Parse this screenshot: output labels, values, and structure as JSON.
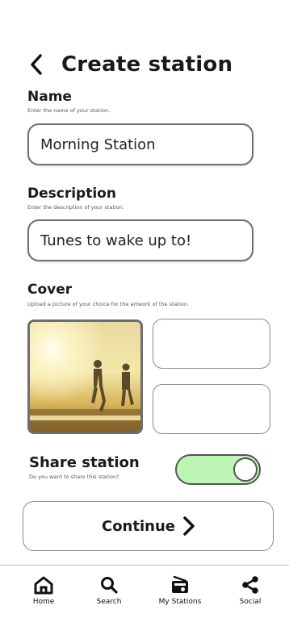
{
  "header": {
    "title": "Create station"
  },
  "name": {
    "label": "Name",
    "hint": "Enter the name of your station.",
    "value": "Morning Station"
  },
  "description": {
    "label": "Description",
    "hint": "Enter the description of your station.",
    "value": "Tunes to wake up to!"
  },
  "cover": {
    "label": "Cover",
    "hint": "Upload a picture of your choice for the artwork of the station."
  },
  "share": {
    "label": "Share station",
    "hint": "Do you want to share this station?",
    "enabled": true
  },
  "continue_label": "Continue",
  "nav": {
    "items": [
      {
        "label": "Home",
        "icon": "home-icon"
      },
      {
        "label": "Search",
        "icon": "search-icon"
      },
      {
        "label": "My Stations",
        "icon": "radio-icon"
      },
      {
        "label": "Social",
        "icon": "share-icon"
      }
    ]
  },
  "colors": {
    "toggle_on": "#bdf5b5",
    "border": "#6e6e6e"
  }
}
